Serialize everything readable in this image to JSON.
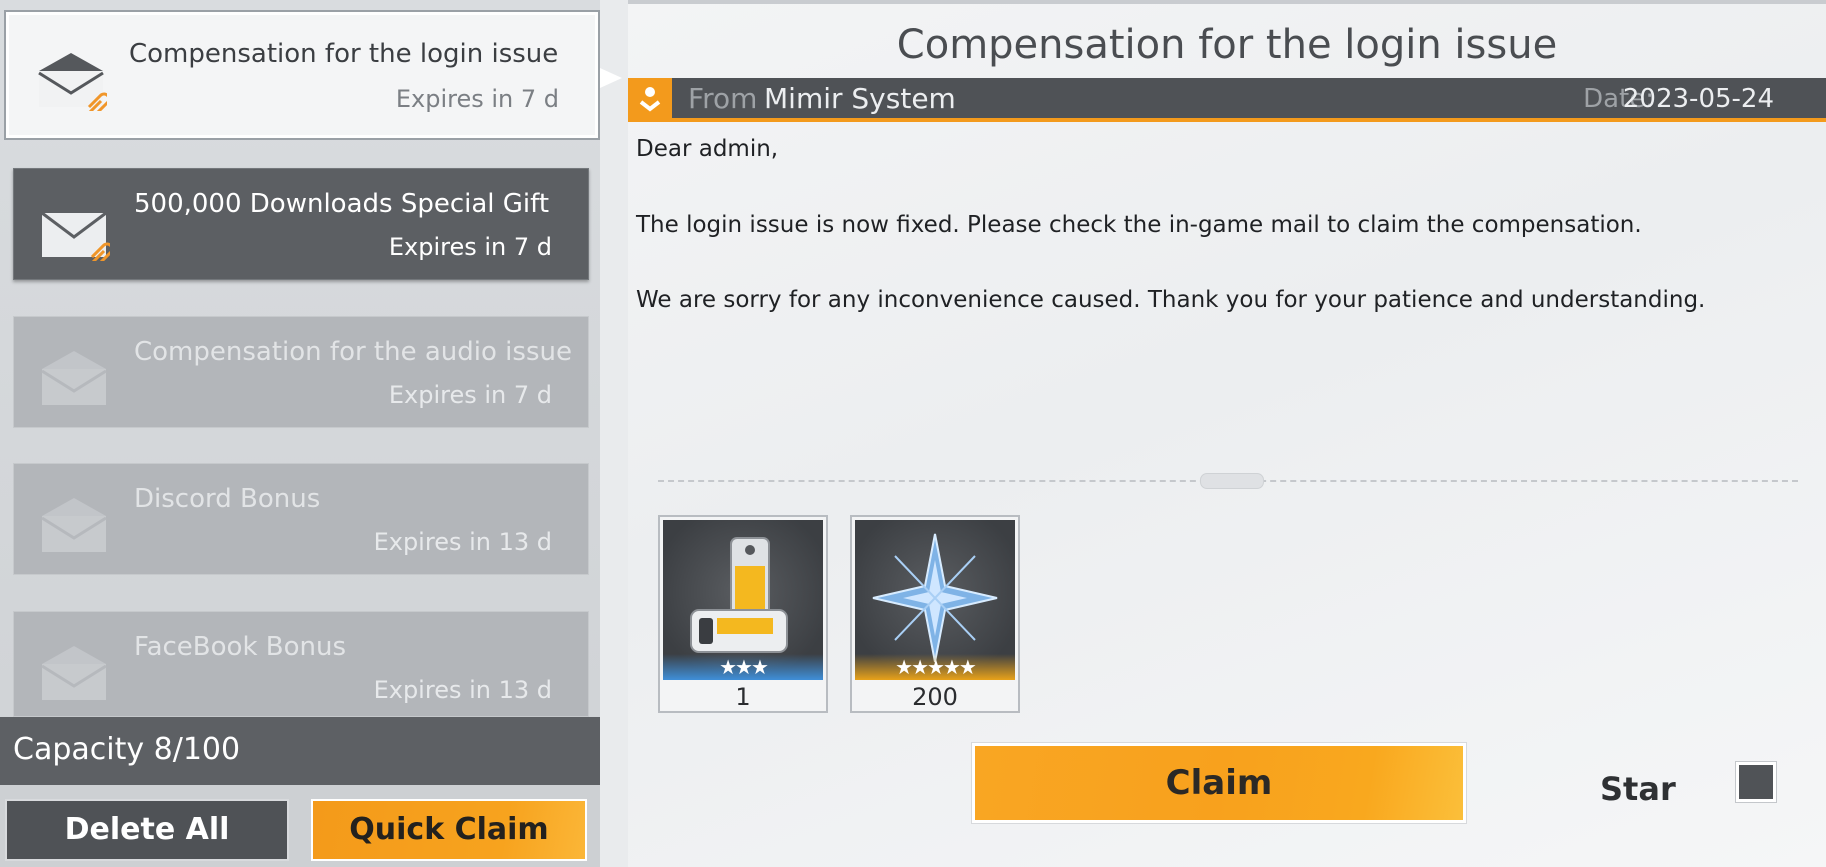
{
  "mail_list": [
    {
      "subject": "Compensation for the login issue",
      "expires": "Expires in 7 d",
      "state": "selected"
    },
    {
      "subject": "500,000 Downloads Special Gift",
      "expires": "Expires in 7 d",
      "state": "unread"
    },
    {
      "subject": "Compensation for the audio issue",
      "expires": "Expires in 7 d",
      "state": "read"
    },
    {
      "subject": "Discord Bonus",
      "expires": "Expires in 13 d",
      "state": "read"
    },
    {
      "subject": "FaceBook Bonus",
      "expires": "Expires in 13 d",
      "state": "read"
    }
  ],
  "capacity_label": "Capacity 8/100",
  "buttons": {
    "delete_all": "Delete All",
    "quick_claim": "Quick Claim",
    "claim": "Claim",
    "star": "Star"
  },
  "mail": {
    "title": "Compensation for the login issue",
    "from_label": "From",
    "from_name": "Mimir System",
    "date_label": "Date:",
    "date_value": "2023-05-24",
    "body": [
      "Dear admin,",
      "The login issue is now fixed. Please check the in-game mail to claim the compensation.",
      "We are sorry for any inconvenience caused. Thank you for your patience and understanding."
    ]
  },
  "attachments": [
    {
      "icon": "device-kit-icon",
      "stars": "★★★",
      "rarity_color": "#3f8fd8",
      "qty": "1"
    },
    {
      "icon": "crystal-shard-icon",
      "stars": "★★★★★",
      "rarity_color": "#e8a21a",
      "qty": "200"
    }
  ],
  "colors": {
    "accent": "#f39a1c",
    "dark_panel": "#4f5256"
  }
}
